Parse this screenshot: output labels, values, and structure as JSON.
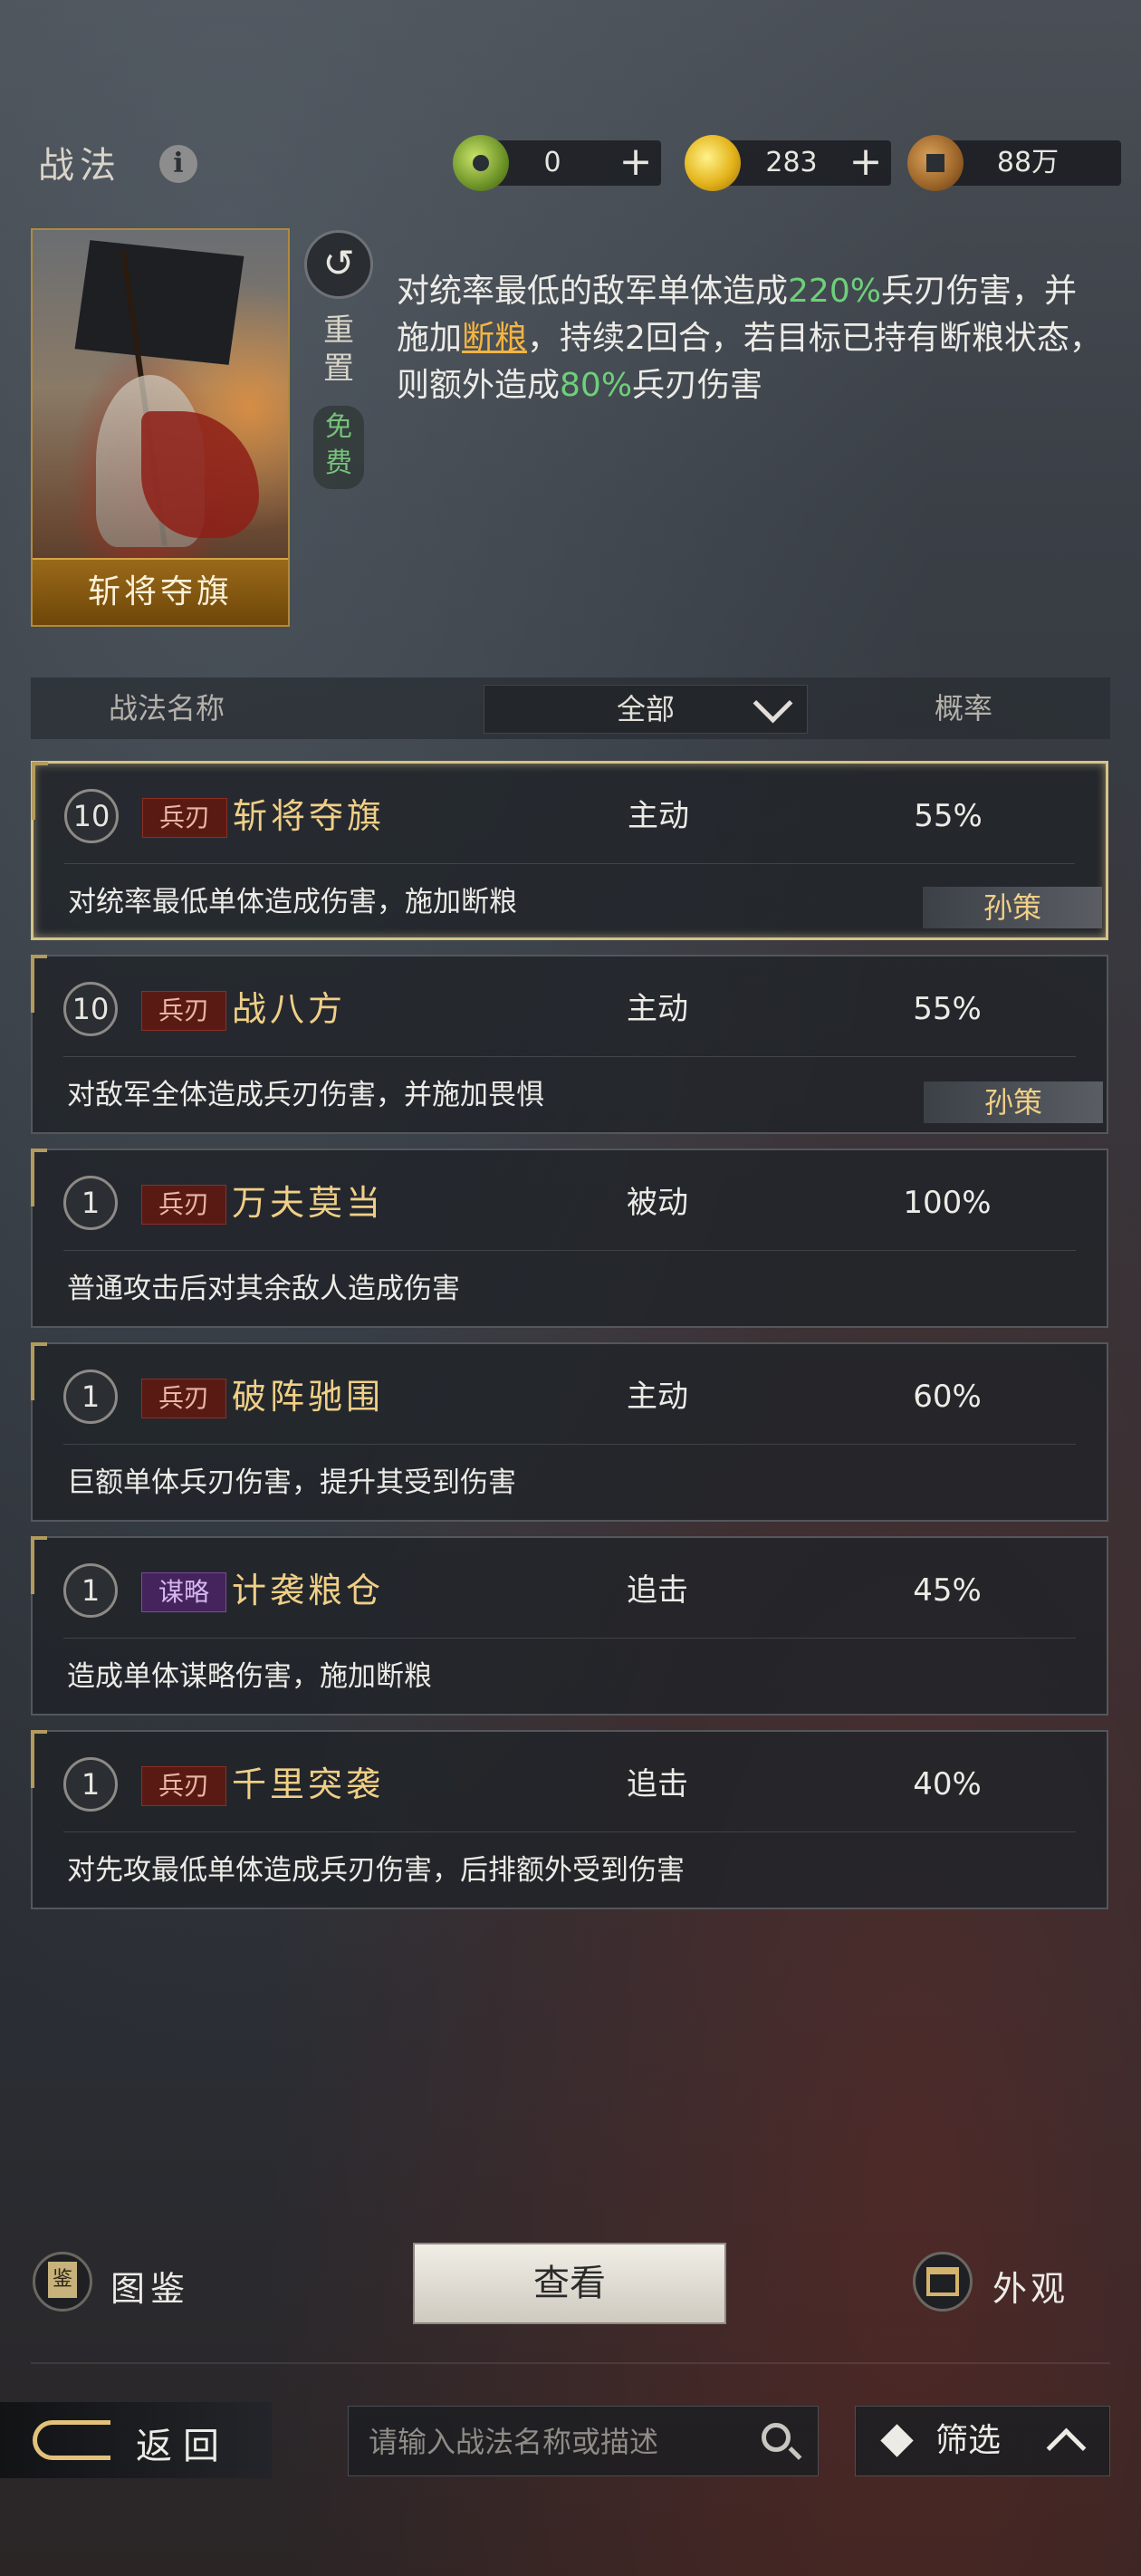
{
  "header": {
    "title": "战法",
    "info_icon": "info-icon"
  },
  "resources": [
    {
      "icon": "jade-coin-icon",
      "value": "0",
      "has_plus": true
    },
    {
      "icon": "gold-ingot-icon",
      "value": "283",
      "has_plus": true
    },
    {
      "icon": "copper-coin-icon",
      "value": "88万",
      "has_plus": false
    }
  ],
  "hero": {
    "name": "斩将夺旗",
    "reset_label": "重置",
    "free_label": "免费",
    "description_parts": [
      "对统率最低的敌军单体造成",
      "220%",
      "兵刃伤害，并施加",
      "断粮",
      "，持续2回合，若目标已持有断粮状态，则额外造成",
      "80%",
      "兵刃伤害"
    ]
  },
  "table": {
    "col_name": "战法名称",
    "col_filter": "全部",
    "col_prob": "概率"
  },
  "tactics": [
    {
      "level": "10",
      "tag": "兵刃",
      "tag_color": "red",
      "name": "斩将夺旗",
      "type": "主动",
      "prob": "55%",
      "desc": "对统率最低单体造成伤害，施加断粮",
      "hero": "孙策",
      "selected": true
    },
    {
      "level": "10",
      "tag": "兵刃",
      "tag_color": "red",
      "name": "战八方",
      "type": "主动",
      "prob": "55%",
      "desc": "对敌军全体造成兵刃伤害，并施加畏惧",
      "hero": "孙策",
      "selected": false
    },
    {
      "level": "1",
      "tag": "兵刃",
      "tag_color": "red",
      "name": "万夫莫当",
      "type": "被动",
      "prob": "100%",
      "desc": "普通攻击后对其余敌人造成伤害",
      "hero": "",
      "selected": false
    },
    {
      "level": "1",
      "tag": "兵刃",
      "tag_color": "red",
      "name": "破阵驰围",
      "type": "主动",
      "prob": "60%",
      "desc": "巨额单体兵刃伤害，提升其受到伤害",
      "hero": "",
      "selected": false
    },
    {
      "level": "1",
      "tag": "谋略",
      "tag_color": "purple",
      "name": "计袭粮仓",
      "type": "追击",
      "prob": "45%",
      "desc": "造成单体谋略伤害，施加断粮",
      "hero": "",
      "selected": false
    },
    {
      "level": "1",
      "tag": "兵刃",
      "tag_color": "red",
      "name": "千里突袭",
      "type": "追击",
      "prob": "40%",
      "desc": "对先攻最低单体造成兵刃伤害，后排额外受到伤害",
      "hero": "",
      "selected": false
    }
  ],
  "bottom": {
    "book_label": "图鉴",
    "view_label": "查看",
    "look_label": "外观",
    "back_label": "返回",
    "search_placeholder": "请输入战法名称或描述",
    "filter_label": "筛选"
  },
  "colors": {
    "highlight_green": "#6dd07a",
    "highlight_orange": "#f2b443",
    "name_gold": "#f0cf86"
  }
}
